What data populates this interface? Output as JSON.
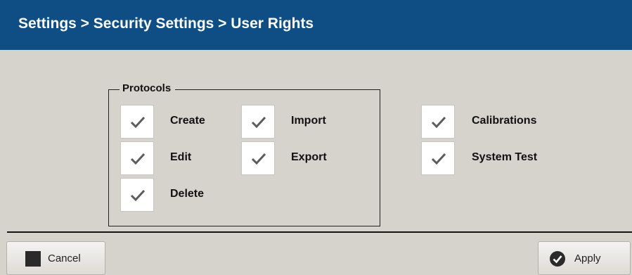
{
  "header": {
    "title": "Settings > Security Settings > User Rights"
  },
  "protocols_group": {
    "legend": "Protocols",
    "options": {
      "create": {
        "label": "Create",
        "checked": true
      },
      "import": {
        "label": "Import",
        "checked": true
      },
      "edit": {
        "label": "Edit",
        "checked": true
      },
      "export": {
        "label": "Export",
        "checked": true
      },
      "delete": {
        "label": "Delete",
        "checked": true
      }
    }
  },
  "other_rights": {
    "calibrations": {
      "label": "Calibrations",
      "checked": true
    },
    "system_test": {
      "label": "System Test",
      "checked": true
    }
  },
  "footer": {
    "cancel_label": "Cancel",
    "cancel_icon": "stop-icon",
    "apply_label": "Apply",
    "apply_icon": "checkmark-circle-icon"
  },
  "colors": {
    "header_bg": "#0e4e84",
    "panel_bg": "#d6d2cc",
    "checkmark": "#5c5c5c"
  }
}
